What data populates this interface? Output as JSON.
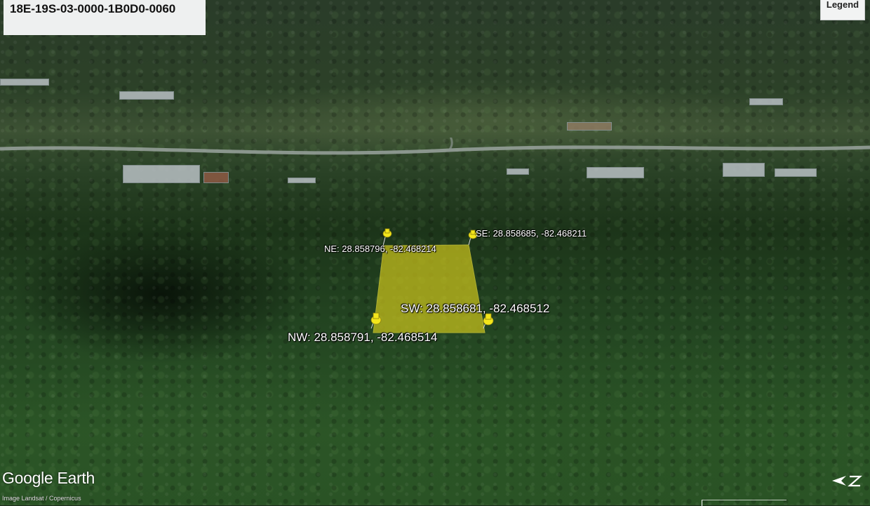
{
  "title": "18E-19S-03-0000-1B0D0-0060",
  "legend_label": "Legend",
  "markers": {
    "ne": "NE: 28.858796, -82.468214",
    "se": "SE: 28.858685, -82.468211",
    "sw": "SW: 28.858681, -82.468512",
    "nw": "NW: 28.858791, -82.468514"
  },
  "parcel_fill_color": "#c9c21c",
  "pin_color": "#f3e61b",
  "brand": "Google Earth",
  "credit": "Image Landsat / Copernicus",
  "compass_icon": "north-arrow-icon"
}
